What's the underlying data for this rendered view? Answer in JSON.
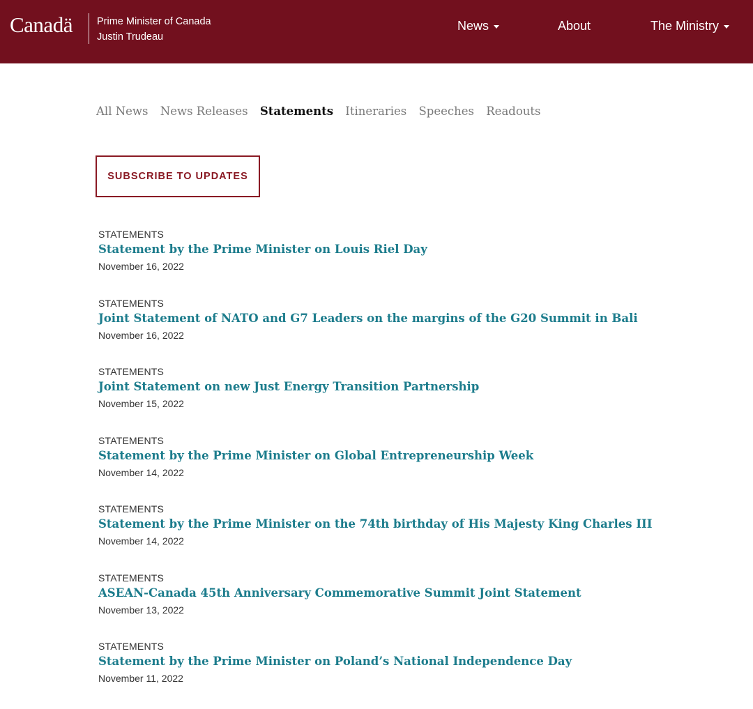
{
  "header": {
    "wordmark": "Canadä",
    "pm_line1": "Prime Minister of Canada",
    "pm_line2": "Justin Trudeau",
    "nav": [
      {
        "label": "News",
        "dropdown": true
      },
      {
        "label": "About",
        "dropdown": false
      },
      {
        "label": "The Ministry",
        "dropdown": true
      }
    ],
    "colors": {
      "bar": "#72101e",
      "accent": "#8a1a24",
      "link": "#1c7c8c"
    }
  },
  "tabs": [
    {
      "label": "All News",
      "active": false
    },
    {
      "label": "News Releases",
      "active": false
    },
    {
      "label": "Statements",
      "active": true
    },
    {
      "label": "Itineraries",
      "active": false
    },
    {
      "label": "Speeches",
      "active": false
    },
    {
      "label": "Readouts",
      "active": false
    }
  ],
  "subscribe_label": "SUBSCRIBE TO UPDATES",
  "items": [
    {
      "kind": "STATEMENTS",
      "title": "Statement by the Prime Minister on Louis Riel Day",
      "date": "November 16, 2022"
    },
    {
      "kind": "STATEMENTS",
      "title": "Joint Statement of NATO and G7 Leaders on the margins of the G20 Summit in Bali",
      "date": "November 16, 2022"
    },
    {
      "kind": "STATEMENTS",
      "title": "Joint Statement on new Just Energy Transition Partnership",
      "date": "November 15, 2022"
    },
    {
      "kind": "STATEMENTS",
      "title": "Statement by the Prime Minister on Global Entrepreneurship Week",
      "date": "November 14, 2022"
    },
    {
      "kind": "STATEMENTS",
      "title": "Statement by the Prime Minister on the 74th birthday of His Majesty King Charles III",
      "date": "November 14, 2022"
    },
    {
      "kind": "STATEMENTS",
      "title": "ASEAN-Canada 45th Anniversary Commemorative Summit Joint Statement",
      "date": "November 13, 2022"
    },
    {
      "kind": "STATEMENTS",
      "title": "Statement by the Prime Minister on Poland’s National Independence Day",
      "date": "November 11, 2022"
    }
  ]
}
